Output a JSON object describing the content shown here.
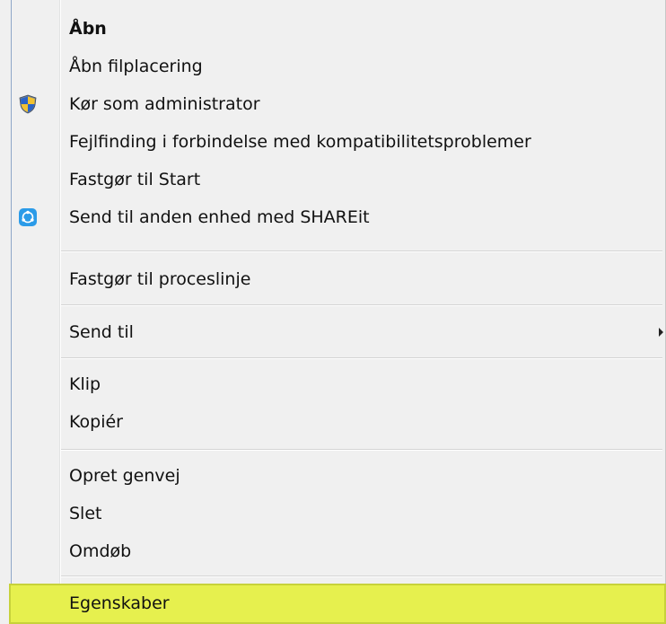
{
  "context_menu": {
    "items": [
      {
        "label": "Åbn"
      },
      {
        "label": "Åbn filplacering"
      },
      {
        "label": "Kør som administrator"
      },
      {
        "label": "Fejlfinding i forbindelse med kompatibilitetsproblemer"
      },
      {
        "label": "Fastgør til Start"
      },
      {
        "label": "Send til anden enhed med SHAREit"
      },
      {
        "label": "Fastgør til proceslinje"
      },
      {
        "label": "Send til"
      },
      {
        "label": "Klip"
      },
      {
        "label": "Kopiér"
      },
      {
        "label": "Opret genvej"
      },
      {
        "label": "Slet"
      },
      {
        "label": "Omdøb"
      },
      {
        "label": "Egenskaber"
      }
    ],
    "icons": {
      "run_as_admin": "uac-shield-icon",
      "shareit": "shareit-icon",
      "send_to_submenu": "submenu-arrow-icon"
    },
    "colors": {
      "menu_background": "#f0f0f0",
      "highlight": "#e6f04e",
      "shareit_blue": "#2b9be8"
    }
  }
}
